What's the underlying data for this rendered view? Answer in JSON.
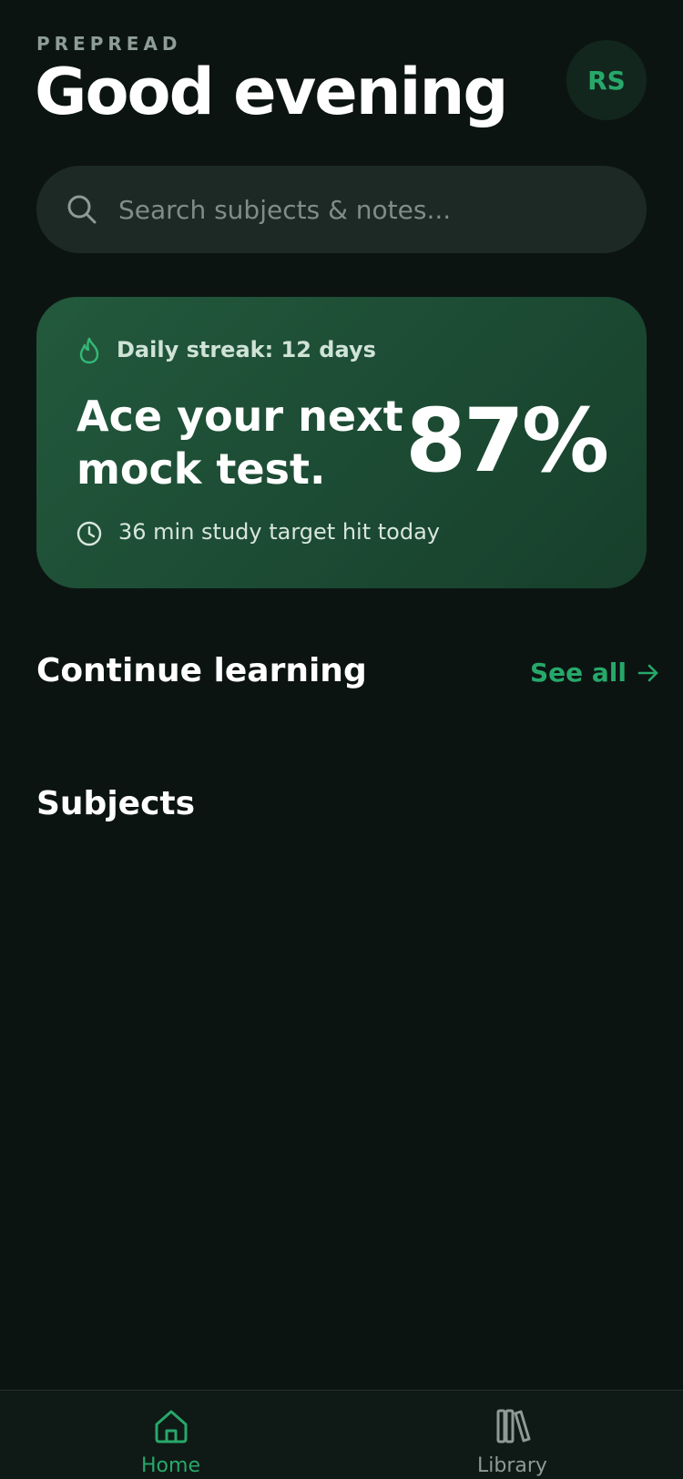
{
  "header": {
    "brand": "PREPREAD",
    "greeting": "Good evening",
    "avatar_initials": "RS"
  },
  "search": {
    "placeholder": "Search subjects & notes...",
    "value": ""
  },
  "hero": {
    "streak": "Daily streak: 12 days",
    "title": "Ace your next mock test.",
    "percent": "87%",
    "subtitle": "36 min study target hit today"
  },
  "continue_learning": {
    "title": "Continue learning",
    "see_all": "See all"
  },
  "subjects": {
    "title": "Subjects"
  },
  "tabbar": {
    "items": [
      {
        "label": "Home",
        "icon": "home-icon",
        "active": true
      },
      {
        "label": "Library",
        "icon": "library-icon",
        "active": false
      }
    ]
  },
  "colors": {
    "background": "#0c1412",
    "accent": "#27a86a",
    "card": "#1c4b33",
    "search_bg": "#1d2925"
  }
}
